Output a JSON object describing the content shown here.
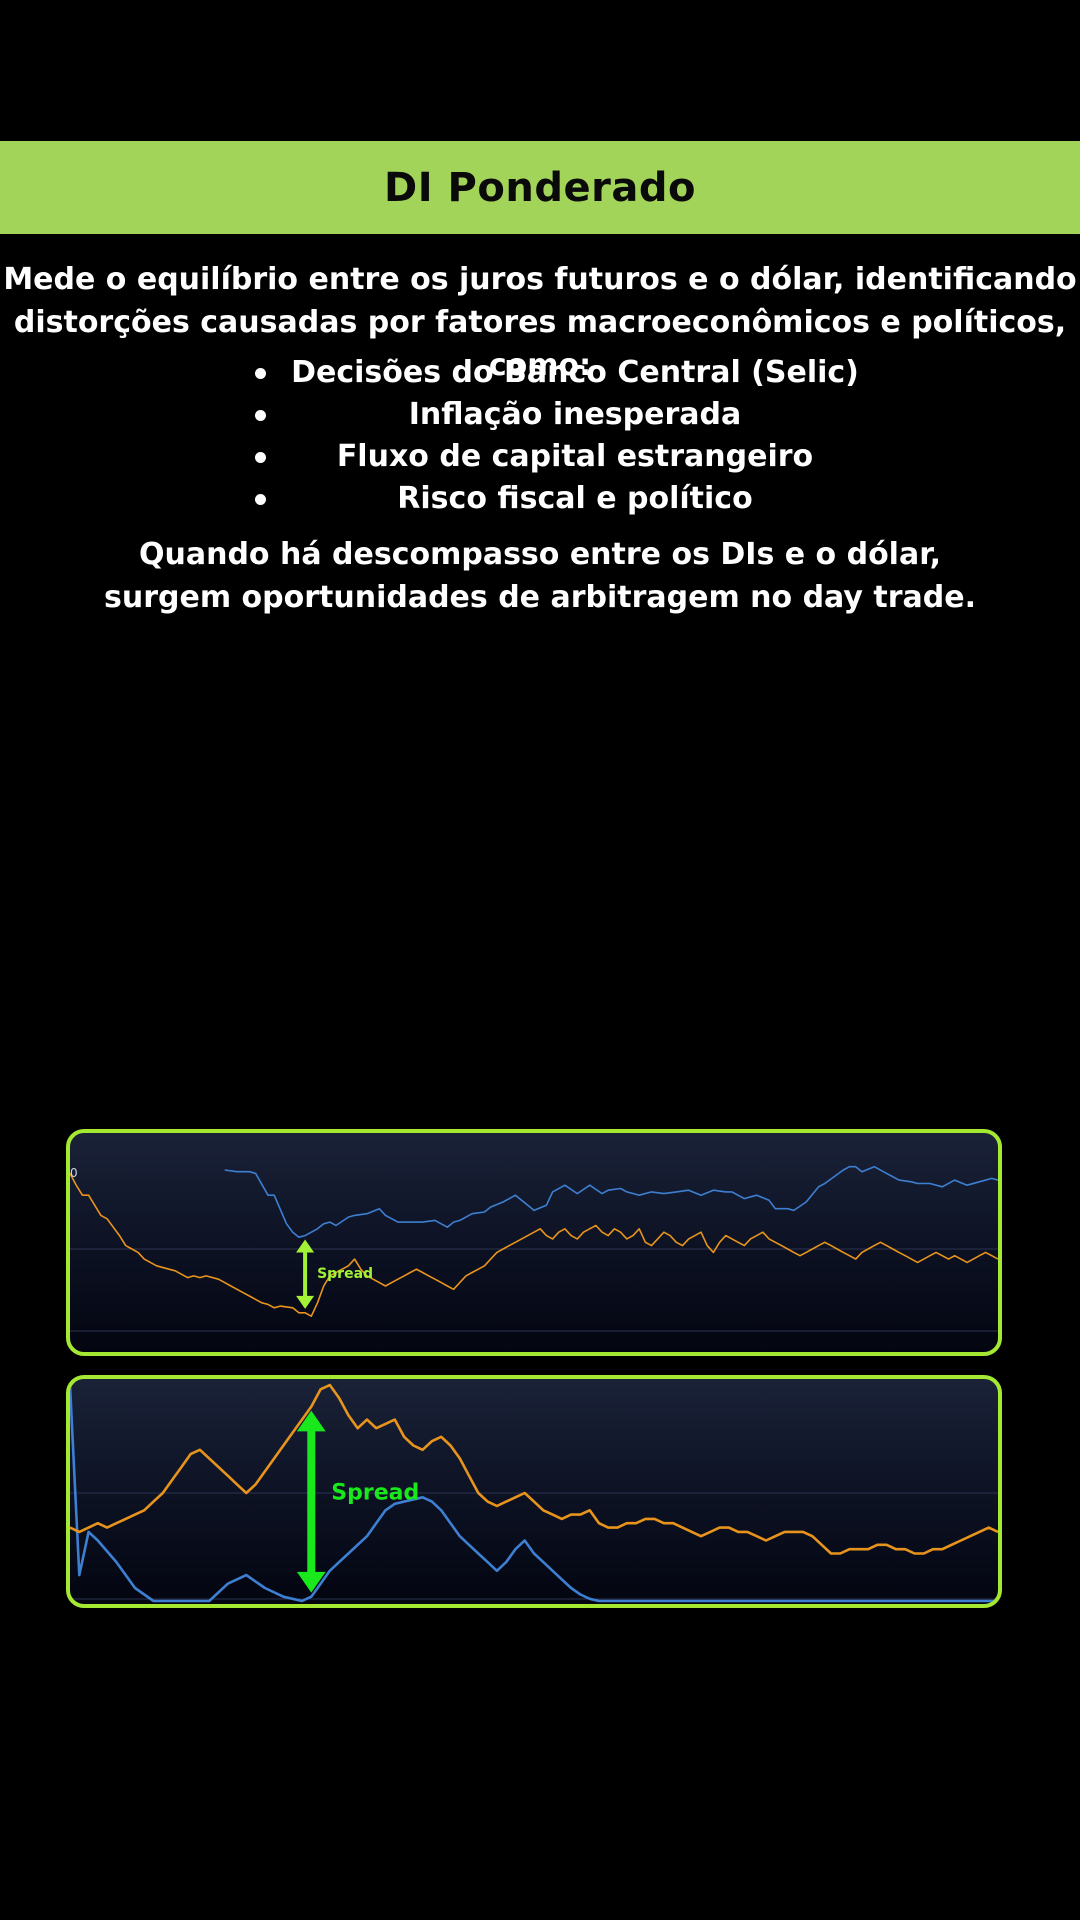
{
  "header": {
    "title": "DI Ponderado",
    "band_color": "#a3d45a"
  },
  "intro": {
    "line1": "Mede o equilíbrio entre os juros futuros e o dólar, identificando",
    "line2": "distorções causadas  por fatores macroeconômicos e políticos, como:"
  },
  "bullets": [
    "Decisões do Banco Central (Selic)",
    "Inflação inesperada",
    "Fluxo de capital estrangeiro",
    "Risco fiscal e político"
  ],
  "outro": {
    "line1": "Quando há descompasso entre os DIs e o dólar,",
    "line2": "surgem oportunidades de arbitragem no day trade."
  },
  "colors": {
    "panel_border": "#a4e832",
    "series_blue": "#3d7fd1",
    "series_orange": "#e8941c",
    "arrow_1": "#a4f235",
    "arrow_2": "#19e81c",
    "gridline": "#2a3250"
  },
  "chart_data": [
    {
      "type": "line",
      "corner_label": "0",
      "annotation": "Spread",
      "ylim": [
        0,
        100
      ],
      "grid": true,
      "annotation_x": 38,
      "annotation_from_series": 1,
      "annotation_to_series": 0,
      "series": [
        {
          "color": "blue",
          "x": [
            25,
            27,
            29,
            30,
            32,
            33,
            35,
            36,
            37,
            38,
            40,
            41,
            42,
            43,
            45,
            46,
            48,
            50,
            51,
            53,
            55,
            57,
            59,
            61,
            62,
            63,
            65,
            67,
            68,
            70,
            72,
            74,
            75,
            77,
            78,
            80,
            82,
            84,
            86,
            87,
            89,
            90,
            92,
            94,
            96,
            98,
            100,
            102,
            104,
            106,
            107,
            109,
            111,
            113,
            114,
            116,
            117,
            119,
            121,
            122,
            125,
            126,
            127,
            128,
            130,
            132,
            134,
            136,
            137,
            139,
            141,
            143,
            145,
            147,
            149,
            150
          ],
          "y": [
            97,
            96,
            96,
            95,
            82,
            82,
            65,
            60,
            57,
            58,
            62,
            65,
            66,
            64,
            69,
            70,
            71,
            74,
            70,
            66,
            66,
            66,
            67,
            63,
            66,
            67,
            71,
            72,
            75,
            78,
            82,
            76,
            73,
            76,
            84,
            88,
            83,
            88,
            83,
            85,
            86,
            84,
            82,
            84,
            83,
            84,
            85,
            82,
            85,
            84,
            84,
            80,
            82,
            79,
            74,
            74,
            73,
            78,
            87,
            89,
            97,
            99,
            99,
            96,
            99,
            95,
            91,
            90,
            89,
            89,
            87,
            91,
            88,
            90,
            92,
            91
          ]
        },
        {
          "color": "orange",
          "x": [
            0,
            1,
            2,
            3,
            5,
            6,
            8,
            9,
            10,
            11,
            12,
            13,
            14,
            16,
            17,
            18,
            19,
            20,
            21,
            22,
            24,
            25,
            26,
            27,
            28,
            29,
            30,
            31,
            32,
            33,
            34,
            36,
            37,
            38,
            39,
            40,
            41,
            42,
            43,
            44,
            45,
            46,
            47,
            48,
            49,
            50,
            51,
            52,
            53,
            54,
            55,
            56,
            57,
            58,
            59,
            60,
            61,
            62,
            63,
            64,
            65,
            66,
            67,
            68,
            69,
            70,
            71,
            72,
            73,
            74,
            75,
            76,
            77,
            78,
            79,
            80,
            81,
            82,
            83,
            84,
            85,
            86,
            87,
            88,
            89,
            90,
            91,
            92,
            93,
            94,
            95,
            96,
            97,
            98,
            99,
            100,
            101,
            102,
            103,
            104,
            105,
            106,
            107,
            108,
            109,
            110,
            111,
            112,
            113,
            114,
            115,
            116,
            117,
            118,
            119,
            120,
            121,
            122,
            123,
            124,
            125,
            126,
            127,
            128,
            129,
            130,
            131,
            132,
            133,
            134,
            135,
            136,
            137,
            138,
            139,
            140,
            141,
            142,
            143,
            144,
            145,
            146,
            147,
            148,
            149,
            150
          ],
          "y": [
            95,
            88,
            82,
            82,
            70,
            68,
            58,
            52,
            50,
            48,
            44,
            42,
            40,
            38,
            37,
            35,
            33,
            34,
            33,
            34,
            32,
            30,
            28,
            26,
            24,
            22,
            20,
            18,
            17,
            15,
            16,
            15,
            12,
            12,
            10,
            18,
            28,
            34,
            36,
            38,
            40,
            44,
            38,
            34,
            32,
            30,
            28,
            30,
            32,
            34,
            36,
            38,
            36,
            34,
            32,
            30,
            28,
            26,
            30,
            34,
            36,
            38,
            40,
            44,
            48,
            50,
            52,
            54,
            56,
            58,
            60,
            62,
            58,
            56,
            60,
            62,
            58,
            56,
            60,
            62,
            64,
            60,
            58,
            62,
            60,
            56,
            58,
            62,
            54,
            52,
            56,
            60,
            58,
            54,
            52,
            56,
            58,
            60,
            52,
            48,
            54,
            58,
            56,
            54,
            52,
            56,
            58,
            60,
            56,
            54,
            52,
            50,
            48,
            46,
            48,
            50,
            52,
            54,
            52,
            50,
            48,
            46,
            44,
            48,
            50,
            52,
            54,
            52,
            50,
            48,
            46,
            44,
            42,
            44,
            46,
            48,
            46,
            44,
            46,
            44,
            42,
            44,
            46,
            48,
            46,
            44
          ]
        }
      ]
    },
    {
      "type": "line",
      "annotation": "Spread",
      "ylim": [
        0,
        100
      ],
      "grid": true,
      "annotation_x": 26,
      "annotation_from_series": 1,
      "annotation_to_series": 0,
      "series": [
        {
          "color": "blue",
          "x": [
            0,
            1,
            2,
            3,
            5,
            7,
            9,
            11,
            13,
            15,
            17,
            19,
            21,
            23,
            25,
            26,
            27,
            28,
            29,
            30,
            31,
            32,
            33,
            34,
            35,
            36,
            37,
            38,
            39,
            40,
            41,
            42,
            43,
            44,
            45,
            46,
            47,
            48,
            49,
            50,
            51,
            52,
            53,
            54,
            55,
            56,
            57,
            58,
            59,
            60,
            61,
            62,
            63,
            64,
            65,
            66,
            67,
            68,
            69,
            70,
            71,
            72,
            73,
            74,
            75,
            76,
            77,
            78,
            79,
            80,
            81,
            82,
            83,
            84,
            85,
            86,
            87,
            88,
            89,
            90,
            91,
            92,
            93,
            94,
            95,
            96,
            97,
            98,
            99,
            100
          ],
          "y": [
            100,
            12,
            32,
            28,
            18,
            6,
            0,
            0,
            0,
            0,
            8,
            12,
            6,
            2,
            0,
            2,
            8,
            14,
            18,
            22,
            26,
            30,
            36,
            42,
            45,
            46,
            47,
            48,
            46,
            42,
            36,
            30,
            26,
            22,
            18,
            14,
            18,
            24,
            28,
            22,
            18,
            14,
            10,
            6,
            3,
            1,
            0,
            0,
            0,
            0,
            0,
            0,
            0,
            0,
            0,
            0,
            0,
            0,
            0,
            0,
            0,
            0,
            0,
            0,
            0,
            0,
            0,
            0,
            0,
            0,
            0,
            0,
            0,
            0,
            0,
            0,
            0,
            0,
            0,
            0,
            0,
            0,
            0,
            0,
            0,
            0,
            0,
            0,
            0,
            0
          ]
        },
        {
          "color": "orange",
          "x": [
            0,
            1,
            2,
            3,
            4,
            5,
            6,
            7,
            8,
            9,
            10,
            11,
            12,
            13,
            14,
            15,
            16,
            17,
            18,
            19,
            20,
            21,
            22,
            23,
            24,
            25,
            26,
            27,
            28,
            29,
            30,
            31,
            32,
            33,
            34,
            35,
            36,
            37,
            38,
            39,
            40,
            41,
            42,
            43,
            44,
            45,
            46,
            47,
            48,
            49,
            50,
            51,
            52,
            53,
            54,
            55,
            56,
            57,
            58,
            59,
            60,
            61,
            62,
            63,
            64,
            65,
            66,
            67,
            68,
            69,
            70,
            71,
            72,
            73,
            74,
            75,
            76,
            77,
            78,
            79,
            80,
            81,
            82,
            83,
            84,
            85,
            86,
            87,
            88,
            89,
            90,
            91,
            92,
            93,
            94,
            95,
            96,
            97,
            98,
            99,
            100
          ],
          "y": [
            34,
            32,
            34,
            36,
            34,
            36,
            38,
            40,
            42,
            46,
            50,
            56,
            62,
            68,
            70,
            66,
            62,
            58,
            54,
            50,
            54,
            60,
            66,
            72,
            78,
            84,
            90,
            98,
            100,
            94,
            86,
            80,
            84,
            80,
            82,
            84,
            76,
            72,
            70,
            74,
            76,
            72,
            66,
            58,
            50,
            46,
            44,
            46,
            48,
            50,
            46,
            42,
            40,
            38,
            40,
            40,
            42,
            36,
            34,
            34,
            36,
            36,
            38,
            38,
            36,
            36,
            34,
            32,
            30,
            32,
            34,
            34,
            32,
            32,
            30,
            28,
            30,
            32,
            32,
            32,
            30,
            26,
            22,
            22,
            24,
            24,
            24,
            26,
            26,
            24,
            24,
            22,
            22,
            24,
            24,
            26,
            28,
            30,
            32,
            34,
            32
          ]
        }
      ]
    }
  ]
}
